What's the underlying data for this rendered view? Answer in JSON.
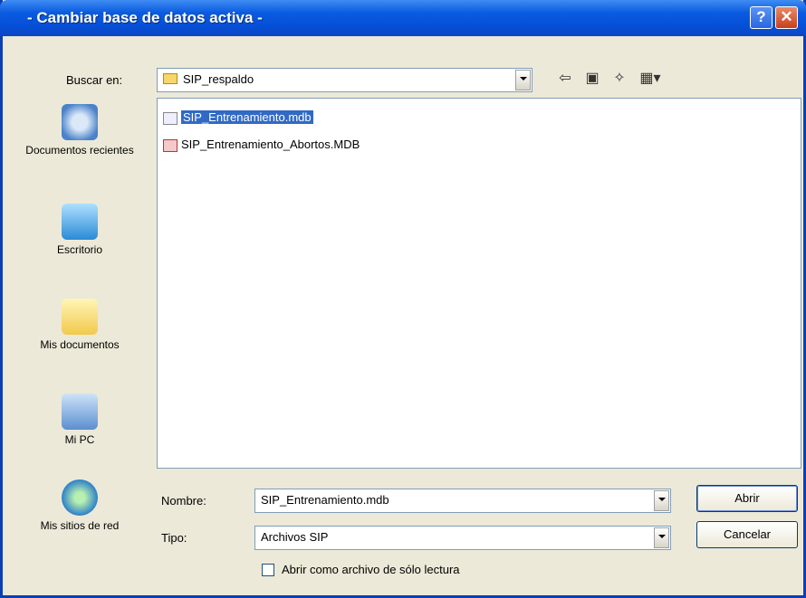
{
  "window": {
    "title": "- Cambiar base de datos activa -"
  },
  "titlebar": {
    "help_icon": "question-mark",
    "close_icon": "x"
  },
  "lookin": {
    "label": "Buscar en:",
    "value": "SIP_respaldo",
    "toolbar_icons": [
      "back-icon",
      "up-folder-icon",
      "new-folder-icon",
      "views-icon"
    ]
  },
  "places": [
    {
      "label": "Documentos recientes",
      "icon": "recent-documents-icon"
    },
    {
      "label": "Escritorio",
      "icon": "desktop-icon"
    },
    {
      "label": "Mis documentos",
      "icon": "my-documents-icon"
    },
    {
      "label": "Mi PC",
      "icon": "my-computer-icon"
    },
    {
      "label": "Mis sitios de red",
      "icon": "network-places-icon"
    }
  ],
  "files": [
    {
      "name": "SIP_Entrenamiento.mdb",
      "selected": true
    },
    {
      "name": "SIP_Entrenamiento_Abortos.MDB",
      "selected": false
    }
  ],
  "filename": {
    "label": "Nombre:",
    "value": "SIP_Entrenamiento.mdb"
  },
  "filetype": {
    "label": "Tipo:",
    "value": "Archivos SIP"
  },
  "readonly": {
    "label": "Abrir como archivo de sólo lectura",
    "checked": false
  },
  "buttons": {
    "open": "Abrir",
    "cancel": "Cancelar"
  },
  "colors": {
    "titlebar": "#0550d8",
    "selection": "#316ac5",
    "dialog_bg": "#ece9d8"
  }
}
